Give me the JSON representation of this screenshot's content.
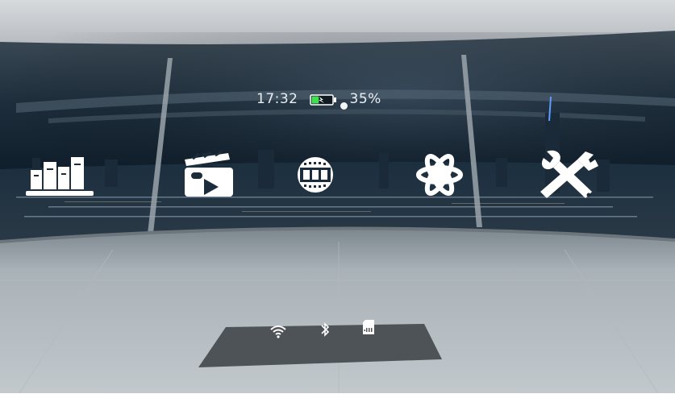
{
  "status_bar": {
    "time": "17:32",
    "battery_percent": "35%",
    "battery_level": 0.35,
    "battery_icon": "battery-charging-icon",
    "indicator": "connection-dot-icon"
  },
  "apps": [
    {
      "icon": "library-books-icon"
    },
    {
      "icon": "video-clapperboard-play-icon"
    },
    {
      "icon": "cinema-film-icon"
    },
    {
      "icon": "atom-icon"
    },
    {
      "icon": "settings-tools-icon"
    }
  ],
  "system_tray": [
    {
      "icon": "wifi-icon"
    },
    {
      "icon": "bluetooth-icon"
    },
    {
      "icon": "sd-card-icon"
    }
  ],
  "colors": {
    "battery_green": "#3fe04f",
    "icon_white": "#ffffff",
    "floor": "#aab3ba",
    "sky": "#0c1c2c"
  }
}
